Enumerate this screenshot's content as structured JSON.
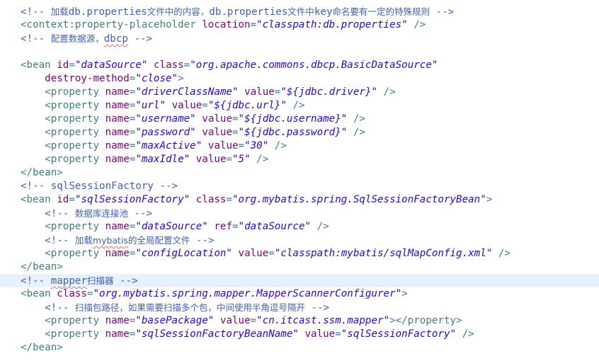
{
  "lines": [
    {
      "segs": [
        {
          "c": "c",
          "t": "<!-- "
        },
        {
          "c": "c cn",
          "t": "加载"
        },
        {
          "c": "c",
          "t": "db.properties"
        },
        {
          "c": "c cn",
          "t": "文件中的内容，"
        },
        {
          "c": "c",
          "t": "db.properties"
        },
        {
          "c": "c cn",
          "t": "文件中"
        },
        {
          "c": "c",
          "t": "key"
        },
        {
          "c": "c cn",
          "t": "命名要有一定的特殊规则"
        },
        {
          "c": "c",
          "t": " -->"
        }
      ]
    },
    {
      "segs": [
        {
          "c": "t",
          "t": "<context:property-placeholder "
        },
        {
          "c": "a",
          "t": "location"
        },
        {
          "c": "t",
          "t": "="
        },
        {
          "c": "v",
          "t": "\"classpath:db.properties\""
        },
        {
          "c": "t",
          "t": " />"
        }
      ]
    },
    {
      "segs": [
        {
          "c": "c",
          "t": "<!-- "
        },
        {
          "c": "c cn",
          "t": "配置数据源，"
        },
        {
          "c": "c sq",
          "t": "dbcp"
        },
        {
          "c": "c",
          "t": " -->"
        }
      ]
    },
    {
      "segs": []
    },
    {
      "segs": [
        {
          "c": "t",
          "t": "<bean "
        },
        {
          "c": "a",
          "t": "id"
        },
        {
          "c": "t",
          "t": "="
        },
        {
          "c": "v",
          "t": "\"dataSource\""
        },
        {
          "c": "t",
          "t": " "
        },
        {
          "c": "a",
          "t": "class"
        },
        {
          "c": "t",
          "t": "="
        },
        {
          "c": "v",
          "t": "\"org.apache.commons.dbcp.BasicDataSource\""
        }
      ]
    },
    {
      "segs": [
        {
          "c": "t",
          "t": "    "
        },
        {
          "c": "a",
          "t": "destroy-method"
        },
        {
          "c": "t",
          "t": "="
        },
        {
          "c": "v",
          "t": "\"close\""
        },
        {
          "c": "t",
          "t": ">"
        }
      ]
    },
    {
      "segs": [
        {
          "c": "t",
          "t": "    <property "
        },
        {
          "c": "a",
          "t": "name"
        },
        {
          "c": "t",
          "t": "="
        },
        {
          "c": "v",
          "t": "\"driverClassName\""
        },
        {
          "c": "t",
          "t": " "
        },
        {
          "c": "a",
          "t": "value"
        },
        {
          "c": "t",
          "t": "="
        },
        {
          "c": "v",
          "t": "\"${jdbc.driver}\""
        },
        {
          "c": "t",
          "t": " />"
        }
      ]
    },
    {
      "segs": [
        {
          "c": "t",
          "t": "    <property "
        },
        {
          "c": "a",
          "t": "name"
        },
        {
          "c": "t",
          "t": "="
        },
        {
          "c": "v",
          "t": "\"url\""
        },
        {
          "c": "t",
          "t": " "
        },
        {
          "c": "a",
          "t": "value"
        },
        {
          "c": "t",
          "t": "="
        },
        {
          "c": "v",
          "t": "\"${jdbc.url}\""
        },
        {
          "c": "t",
          "t": " />"
        }
      ]
    },
    {
      "segs": [
        {
          "c": "t",
          "t": "    <property "
        },
        {
          "c": "a",
          "t": "name"
        },
        {
          "c": "t",
          "t": "="
        },
        {
          "c": "v",
          "t": "\"username\""
        },
        {
          "c": "t",
          "t": " "
        },
        {
          "c": "a",
          "t": "value"
        },
        {
          "c": "t",
          "t": "="
        },
        {
          "c": "v",
          "t": "\"${jdbc.username}\""
        },
        {
          "c": "t",
          "t": " />"
        }
      ]
    },
    {
      "segs": [
        {
          "c": "t",
          "t": "    <property "
        },
        {
          "c": "a",
          "t": "name"
        },
        {
          "c": "t",
          "t": "="
        },
        {
          "c": "v",
          "t": "\"password\""
        },
        {
          "c": "t",
          "t": " "
        },
        {
          "c": "a",
          "t": "value"
        },
        {
          "c": "t",
          "t": "="
        },
        {
          "c": "v",
          "t": "\"${jdbc.password}\""
        },
        {
          "c": "t",
          "t": " />"
        }
      ]
    },
    {
      "segs": [
        {
          "c": "t",
          "t": "    <property "
        },
        {
          "c": "a",
          "t": "name"
        },
        {
          "c": "t",
          "t": "="
        },
        {
          "c": "v",
          "t": "\"maxActive\""
        },
        {
          "c": "t",
          "t": " "
        },
        {
          "c": "a",
          "t": "value"
        },
        {
          "c": "t",
          "t": "="
        },
        {
          "c": "v",
          "t": "\"30\""
        },
        {
          "c": "t",
          "t": " />"
        }
      ]
    },
    {
      "segs": [
        {
          "c": "t",
          "t": "    <property "
        },
        {
          "c": "a",
          "t": "name"
        },
        {
          "c": "t",
          "t": "="
        },
        {
          "c": "v",
          "t": "\"maxIdle\""
        },
        {
          "c": "t",
          "t": " "
        },
        {
          "c": "a",
          "t": "value"
        },
        {
          "c": "t",
          "t": "="
        },
        {
          "c": "v",
          "t": "\"5\""
        },
        {
          "c": "t",
          "t": " />"
        }
      ]
    },
    {
      "segs": [
        {
          "c": "t",
          "t": "</bean>"
        }
      ]
    },
    {
      "segs": [
        {
          "c": "c",
          "t": "<!-- sqlSessionFactory -->"
        }
      ]
    },
    {
      "segs": [
        {
          "c": "t",
          "t": "<bean "
        },
        {
          "c": "a",
          "t": "id"
        },
        {
          "c": "t",
          "t": "="
        },
        {
          "c": "v",
          "t": "\"sqlSessionFactory\""
        },
        {
          "c": "t",
          "t": " "
        },
        {
          "c": "a",
          "t": "class"
        },
        {
          "c": "t",
          "t": "="
        },
        {
          "c": "v",
          "t": "\"org.mybatis.spring.SqlSessionFactoryBean\""
        },
        {
          "c": "t",
          "t": ">"
        }
      ]
    },
    {
      "segs": [
        {
          "c": "c",
          "t": "    <!-- "
        },
        {
          "c": "c cn",
          "t": "数据库连接池"
        },
        {
          "c": "c",
          "t": " -->"
        }
      ]
    },
    {
      "segs": [
        {
          "c": "t",
          "t": "    <property "
        },
        {
          "c": "a",
          "t": "name"
        },
        {
          "c": "t",
          "t": "="
        },
        {
          "c": "v",
          "t": "\"dataSource\""
        },
        {
          "c": "t",
          "t": " "
        },
        {
          "c": "a",
          "t": "ref"
        },
        {
          "c": "t",
          "t": "="
        },
        {
          "c": "v",
          "t": "\"dataSource\""
        },
        {
          "c": "t",
          "t": " />"
        }
      ]
    },
    {
      "segs": [
        {
          "c": "c",
          "t": "    <!-- "
        },
        {
          "c": "c cn",
          "t": "加载"
        },
        {
          "c": "c cn sq",
          "t": "mybatis"
        },
        {
          "c": "c cn",
          "t": "的全局配置文件"
        },
        {
          "c": "c",
          "t": " -->"
        }
      ]
    },
    {
      "segs": [
        {
          "c": "t",
          "t": "    <property "
        },
        {
          "c": "a",
          "t": "name"
        },
        {
          "c": "t",
          "t": "="
        },
        {
          "c": "v",
          "t": "\"configLocation\""
        },
        {
          "c": "t",
          "t": " "
        },
        {
          "c": "a",
          "t": "value"
        },
        {
          "c": "t",
          "t": "="
        },
        {
          "c": "v",
          "t": "\"classpath:mybatis/sqlMapConfig.xml\""
        },
        {
          "c": "t",
          "t": " />"
        }
      ]
    },
    {
      "segs": [
        {
          "c": "t",
          "t": "</bean>"
        }
      ]
    },
    {
      "hl": true,
      "segs": [
        {
          "c": "c",
          "t": "<!-- "
        },
        {
          "c": "c sq",
          "t": "mapper"
        },
        {
          "c": "c cn",
          "t": "扫描器"
        },
        {
          "c": "c",
          "t": " -->"
        }
      ]
    },
    {
      "segs": [
        {
          "c": "t",
          "t": "<bean "
        },
        {
          "c": "a",
          "t": "class"
        },
        {
          "c": "t",
          "t": "="
        },
        {
          "c": "v",
          "t": "\"org.mybatis.spring.mapper.MapperScannerConfigurer\""
        },
        {
          "c": "t",
          "t": ">"
        }
      ]
    },
    {
      "segs": [
        {
          "c": "c",
          "t": "    <!-- "
        },
        {
          "c": "c cn",
          "t": "扫描包路径，如果需要扫描多个包，中间使用半角逗号隔开"
        },
        {
          "c": "c",
          "t": " -->"
        }
      ]
    },
    {
      "segs": [
        {
          "c": "t",
          "t": "    <property "
        },
        {
          "c": "a",
          "t": "name"
        },
        {
          "c": "t",
          "t": "="
        },
        {
          "c": "v",
          "t": "\"basePackage\""
        },
        {
          "c": "t",
          "t": " "
        },
        {
          "c": "a",
          "t": "value"
        },
        {
          "c": "t",
          "t": "="
        },
        {
          "c": "v",
          "t": "\"cn.itcast.ssm.mapper\""
        },
        {
          "c": "t",
          "t": "></property>"
        }
      ]
    },
    {
      "segs": [
        {
          "c": "t",
          "t": "    <property "
        },
        {
          "c": "a",
          "t": "name"
        },
        {
          "c": "t",
          "t": "="
        },
        {
          "c": "v",
          "t": "\"sqlSessionFactoryBeanName\""
        },
        {
          "c": "t",
          "t": " "
        },
        {
          "c": "a",
          "t": "value"
        },
        {
          "c": "t",
          "t": "="
        },
        {
          "c": "v",
          "t": "\"sqlSessionFactory\""
        },
        {
          "c": "t",
          "t": " />"
        }
      ]
    },
    {
      "segs": [
        {
          "c": "t",
          "t": "</bean>"
        }
      ]
    }
  ],
  "colors": {
    "comment": "#3f5fbf",
    "tag": "#3f7f7f",
    "attribute": "#7f007f",
    "value": "#2a00ff",
    "current_line": "#e8f2fe",
    "spell_squiggle": "#e07070"
  }
}
